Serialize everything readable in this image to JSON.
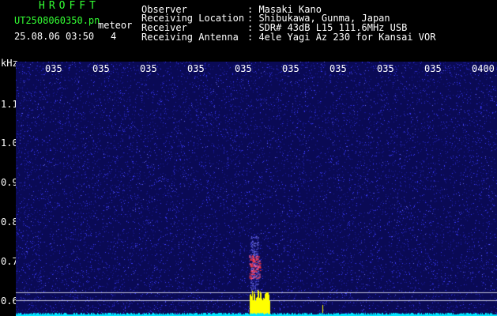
{
  "header": {
    "app_name": "HROFFT",
    "file_name": "UT2508060350.pn",
    "mode": "meteor",
    "date_time": "25.08.06 03:50",
    "count": "4"
  },
  "info": [
    {
      "label": "Observer",
      "value": ": Masaki Kano"
    },
    {
      "label": "Receiving Location",
      "value": ": Shibukawa, Gunma, Japan"
    },
    {
      "label": "Receiver",
      "value": ": SDR# 43dB L15 111.6MHz USB"
    },
    {
      "label": "Receiving Antenna",
      "value": ": 4ele Yagi Az 230 for Kansai VOR"
    }
  ],
  "axis": {
    "y_unit": "kHz",
    "y_ticks": [
      "1.1",
      "1.0",
      "0.9",
      "0.8",
      "0.7",
      "0.6"
    ],
    "x_ticks": [
      "035",
      "035",
      "035",
      "035",
      "035",
      "035",
      "035",
      "035",
      "035",
      "035",
      "0400"
    ]
  },
  "colors": {
    "background": "#000000",
    "noise_dark": "#0a0a55",
    "noise_light": "#3a3aff",
    "signal_red": "#ff3030",
    "signal_yellow": "#ffff00",
    "baseline_cyan": "#00e5ff",
    "text_green": "#33ff33"
  }
}
